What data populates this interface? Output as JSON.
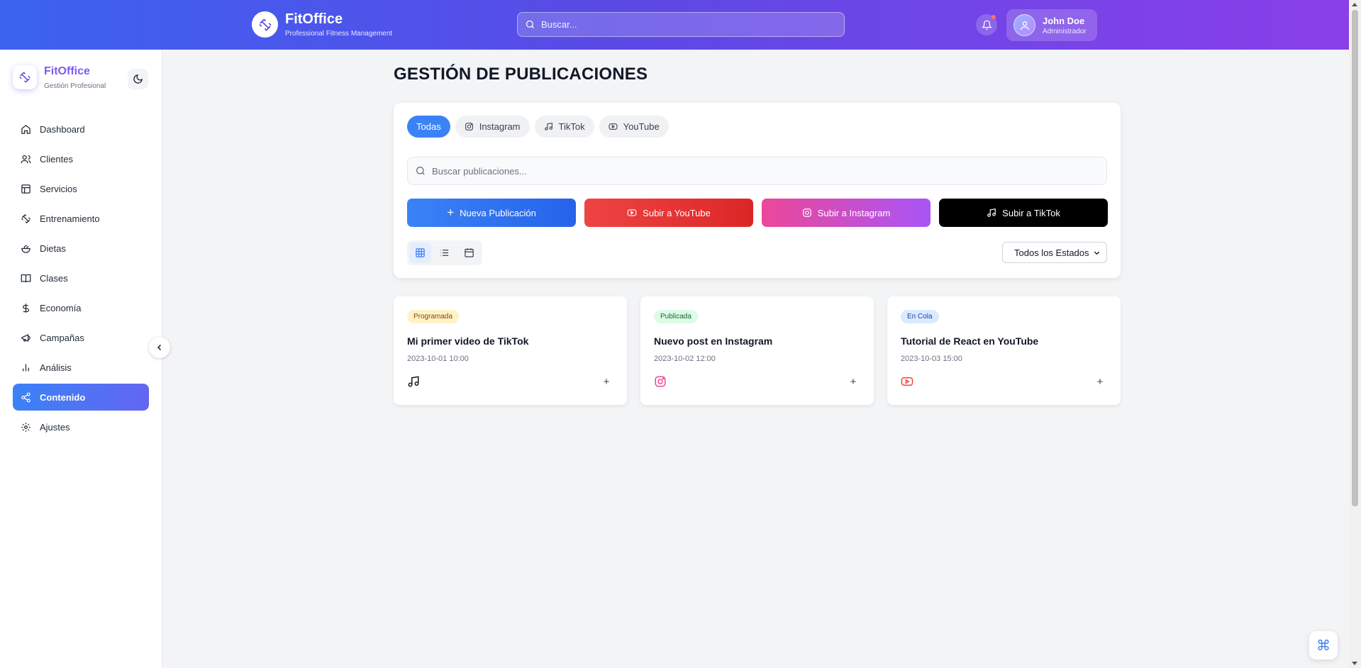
{
  "header": {
    "brand_title": "FitOffice",
    "brand_subtitle": "Professional Fitness Management",
    "search_placeholder": "Buscar...",
    "user_name": "John Doe",
    "user_role": "Administrador"
  },
  "sidebar": {
    "brand_title": "FitOffice",
    "brand_subtitle": "Gestión Profesional",
    "items": [
      {
        "label": "Dashboard",
        "icon": "home-icon"
      },
      {
        "label": "Clientes",
        "icon": "users-icon"
      },
      {
        "label": "Servicios",
        "icon": "layout-icon"
      },
      {
        "label": "Entrenamiento",
        "icon": "dumbbell-icon"
      },
      {
        "label": "Dietas",
        "icon": "salad-icon"
      },
      {
        "label": "Clases",
        "icon": "book-icon"
      },
      {
        "label": "Economía",
        "icon": "dollar-icon"
      },
      {
        "label": "Campañas",
        "icon": "megaphone-icon"
      },
      {
        "label": "Análisis",
        "icon": "bar-chart-icon"
      },
      {
        "label": "Contenido",
        "icon": "share-icon"
      },
      {
        "label": "Ajustes",
        "icon": "gear-icon"
      }
    ],
    "active": "Contenido"
  },
  "main": {
    "title": "GESTIÓN DE PUBLICACIONES",
    "tabs": [
      "Todas",
      "Instagram",
      "TikTok",
      "YouTube"
    ],
    "active_tab": "Todas",
    "search_placeholder": "Buscar publicaciones...",
    "actions": {
      "new": "Nueva Publicación",
      "youtube": "Subir a YouTube",
      "instagram": "Subir a Instagram",
      "tiktok": "Subir a TikTok"
    },
    "status_filter": "Todos los Estados",
    "posts": [
      {
        "status": "Programada",
        "title": "Mi primer video de TikTok",
        "date": "2023-10-01 10:00",
        "platform": "tiktok"
      },
      {
        "status": "Publicada",
        "title": "Nuevo post en Instagram",
        "date": "2023-10-02 12:00",
        "platform": "instagram"
      },
      {
        "status": "En Cola",
        "title": "Tutorial de React en YouTube",
        "date": "2023-10-03 15:00",
        "platform": "youtube"
      }
    ]
  },
  "colors": {
    "accent": "#3b82f6",
    "youtube": "#ef4444",
    "instagram": "#ec4899",
    "tiktok": "#000000"
  }
}
